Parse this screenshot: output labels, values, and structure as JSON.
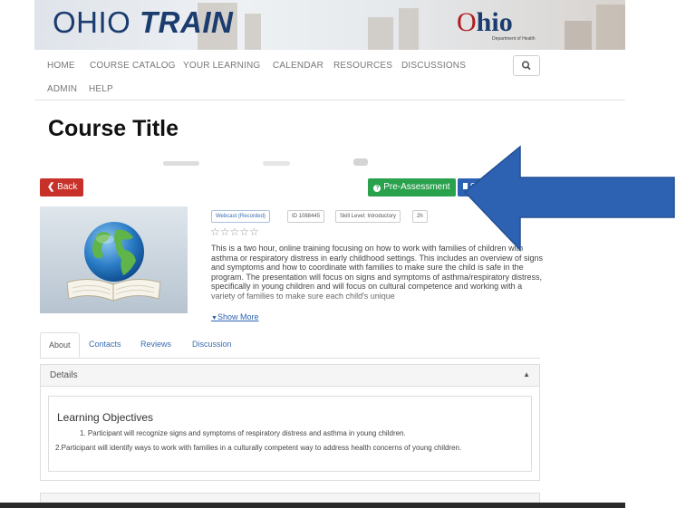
{
  "banner": {
    "brand_part1": "OHIO ",
    "brand_part2": "TRAIN",
    "ohio_o": "O",
    "ohio_hio": "hio",
    "ohio_sub": "Department of Health"
  },
  "nav": {
    "items": [
      "HOME",
      "COURSE CATALOG",
      "YOUR LEARNING",
      "CALENDAR",
      "RESOURCES",
      "DISCUSSIONS",
      "ADMIN",
      "HELP"
    ],
    "search_icon": "search-icon"
  },
  "page": {
    "course_title": "Course Title"
  },
  "actions": {
    "back": "Back",
    "pre_assessment": "Pre-Assessment",
    "save": "S"
  },
  "badges": {
    "type": "Webcast (Recorded)",
    "id": "ID 1088445",
    "skill": "Skill Level: Introductory",
    "duration": "2h"
  },
  "rating": {
    "stars": "☆☆☆☆☆",
    "value_out_of_5": 0
  },
  "description": "This is a two hour, online training focusing on how to work with families of children with asthma or respiratory distress in early childhood settings. This includes an overview of signs and symptoms and how to coordinate with families to make sure the child is safe in the program. The presentation will focus on signs and symptoms of asthma/respiratory distress, specifically in young children and will focus on cultural competence and working with a variety of families to make sure each child's unique",
  "show_more": "Show More",
  "tabs": [
    "About",
    "Contacts",
    "Reviews",
    "Discussion"
  ],
  "details": {
    "title": "Details",
    "objectives_title": "Learning Objectives",
    "objective_1": "1. Participant will recognize signs and symptoms of respiratory distress and asthma in young children.",
    "objective_2": "2.Participant will identify ways to work with families in a culturally competent way to address health concerns of young children."
  },
  "colors": {
    "back": "#c8312a",
    "pre_assessment": "#2aa14c",
    "save": "#2d62b3",
    "arrow": "#2d62b3",
    "brand": "#1b3c6e",
    "ohio_red": "#b01c22"
  }
}
